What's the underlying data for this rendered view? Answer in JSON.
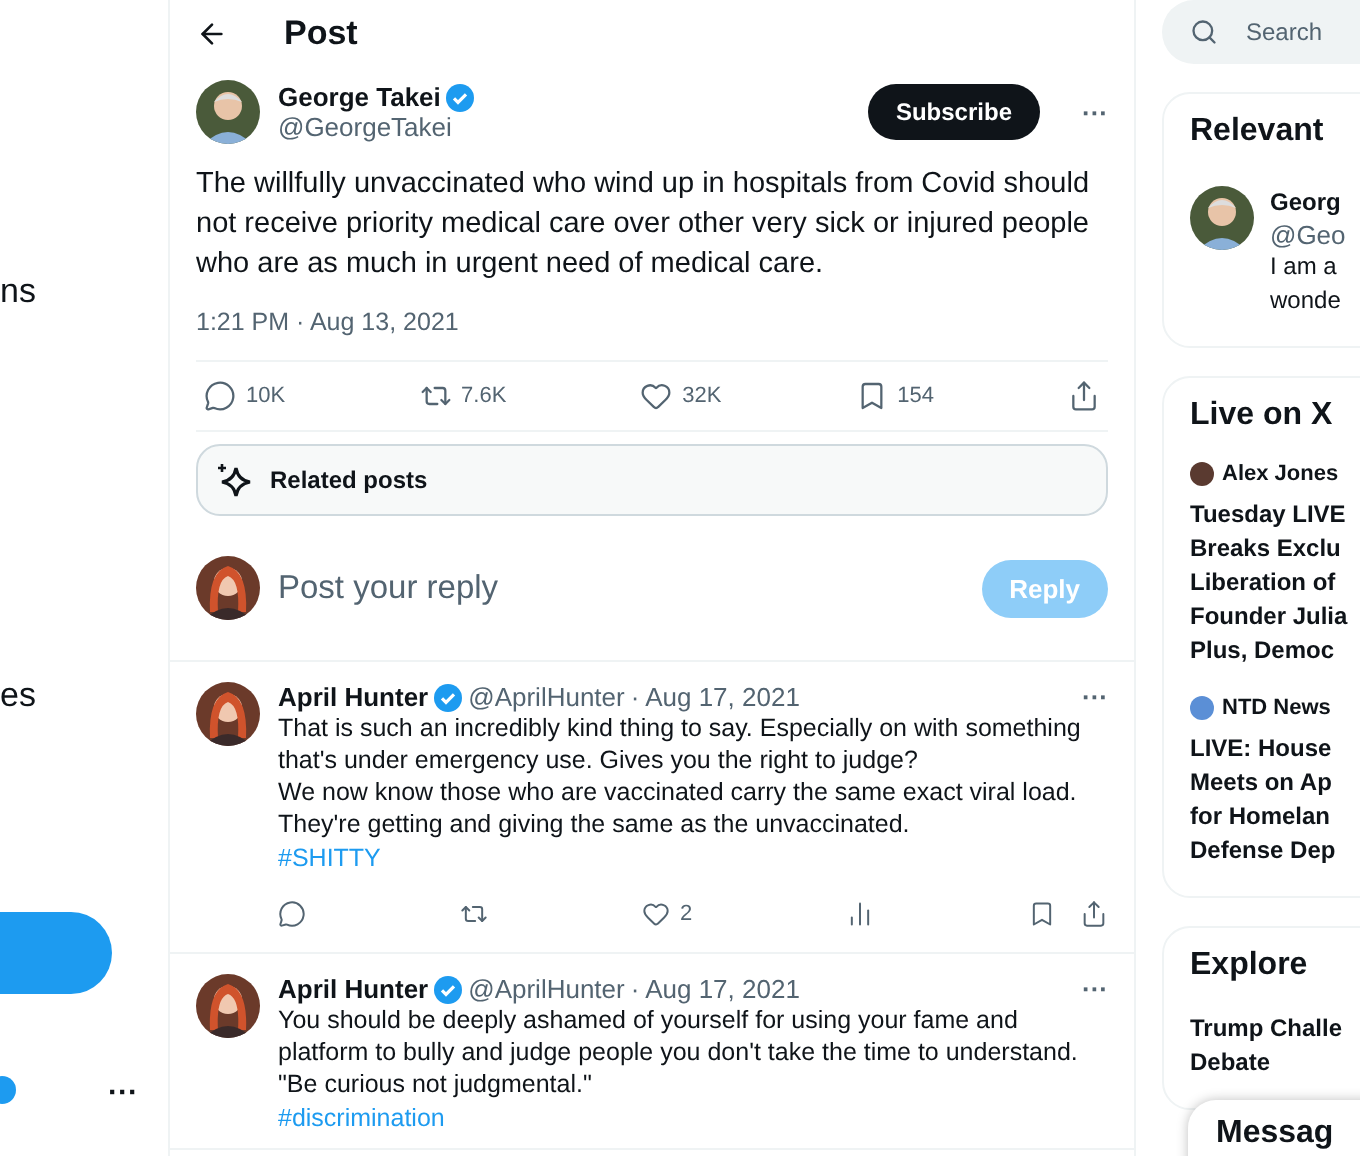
{
  "sidebar": {
    "fragments": [
      "ns",
      "es"
    ],
    "account_more": "···"
  },
  "header": {
    "title": "Post"
  },
  "post": {
    "author": "George Takei",
    "handle": "@GeorgeTakei",
    "verified": true,
    "subscribe": "Subscribe",
    "more": "···",
    "text": "The willfully unvaccinated who wind up in hospitals from Covid should not receive priority medical care over other very sick or injured people who are as much in urgent need of medical care.",
    "time": "1:21 PM · Aug 13, 2021",
    "stats": [
      {
        "kind": "reply",
        "count": "10K"
      },
      {
        "kind": "repost",
        "count": "7.6K"
      },
      {
        "kind": "like",
        "count": "32K"
      },
      {
        "kind": "bookmark",
        "count": "154"
      },
      {
        "kind": "share"
      }
    ]
  },
  "related": {
    "label": "Related posts"
  },
  "composer": {
    "placeholder": "Post your reply",
    "button": "Reply",
    "disabled": true
  },
  "replies": [
    {
      "author": "April Hunter",
      "handle": "@AprilHunter",
      "date": "· Aug 17, 2021",
      "verified": true,
      "more": "···",
      "lines": [
        "That is such an incredibly kind thing to say. Especially on with something that's under emergency use. Gives you the right to judge?",
        "We now know those who are vaccinated carry the same exact viral load. They're getting and giving the same as the unvaccinated."
      ],
      "hashtag": "#SHITTY",
      "likes": "2"
    },
    {
      "author": "April Hunter",
      "handle": "@AprilHunter",
      "date": "· Aug 17, 2021",
      "verified": true,
      "more": "···",
      "lines": [
        "You should be deeply ashamed of yourself for using your fame and platform to bully and judge people you don't take the time to understand.",
        "\"Be curious not judgmental.\""
      ],
      "hashtag": "#discrimination"
    }
  ],
  "search": {
    "placeholder": "Search"
  },
  "relevant": {
    "title": "Relevant",
    "name": "Georg",
    "handle": "@Geo",
    "bio": [
      "I am a",
      "wonde"
    ]
  },
  "live": {
    "title": "Live on X",
    "items": [
      {
        "host": "Alex Jones",
        "lines": [
          "Tuesday LIVE",
          "Breaks Exclu",
          "Liberation of",
          "Founder Julia",
          "Plus, Democ"
        ]
      },
      {
        "host": "NTD News",
        "lines": [
          "LIVE: House",
          "Meets on Ap",
          "for Homelan",
          "Defense Dep"
        ]
      }
    ]
  },
  "explore": {
    "title": "Explore",
    "lines": [
      "Trump Challe",
      "Debate"
    ]
  },
  "messages": {
    "title": "Messag"
  }
}
